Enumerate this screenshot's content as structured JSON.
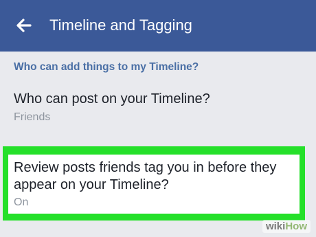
{
  "header": {
    "title": "Timeline and Tagging",
    "back_icon": "back-arrow-icon",
    "background_color": "#3b5998"
  },
  "section": {
    "heading": "Who can add things to my Timeline?"
  },
  "settings": [
    {
      "title": "Who can post on your Timeline?",
      "value": "Friends"
    },
    {
      "title": "Review posts friends tag you in before they appear on your Timeline?",
      "value": "On",
      "highlight_color": "#25e02a"
    }
  ],
  "watermark": {
    "part1": "wiki",
    "part2": "How"
  }
}
